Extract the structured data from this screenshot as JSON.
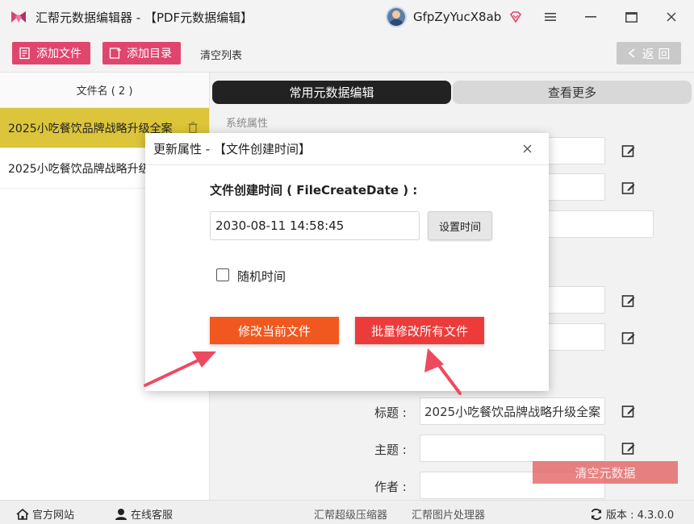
{
  "app": {
    "title": "汇帮元数据编辑器 - 【PDF元数据编辑】",
    "username": "GfpZyYucX8ab",
    "logo_icon": "app-logo-icon",
    "accent_pink": "#e0456e"
  },
  "toolbar": {
    "add_file": "添加文件",
    "add_dir": "添加目录",
    "clear_list": "清空列表",
    "back": "返 回"
  },
  "file_list": {
    "header": "文件名 ( 2 )",
    "files": [
      {
        "name": "2025小吃餐饮品牌战略升级全案",
        "active": true
      },
      {
        "name": "2025小吃餐饮品牌战略升级全案",
        "active": false
      }
    ]
  },
  "tabs": {
    "common": "常用元数据编辑",
    "more": "查看更多"
  },
  "section": {
    "system_props": "系统属性"
  },
  "fields": {
    "title_label": "标题 :",
    "title_value": "2025小吃餐饮品牌战略升级全案",
    "subject_label": "主题 :",
    "author_label": "作者 :"
  },
  "clear_metadata": "清空元数据",
  "statusbar": {
    "official_site": "官方网站",
    "online_service": "在线客服",
    "compressor": "汇帮超级压缩器",
    "image_tool": "汇帮图片处理器",
    "version": "版本 : 4.3.0.0"
  },
  "dialog": {
    "title": "更新属性 - 【文件创建时间】",
    "field_title": "文件创建时间 ( FileCreateDate ) :",
    "time_value": "2030-08-11 14:58:45",
    "set_time": "设置时间",
    "random_time": "随机时间",
    "modify_current": "修改当前文件",
    "modify_all": "批量修改所有文件",
    "orange": "#f0581f",
    "red": "#ec3b3b"
  }
}
